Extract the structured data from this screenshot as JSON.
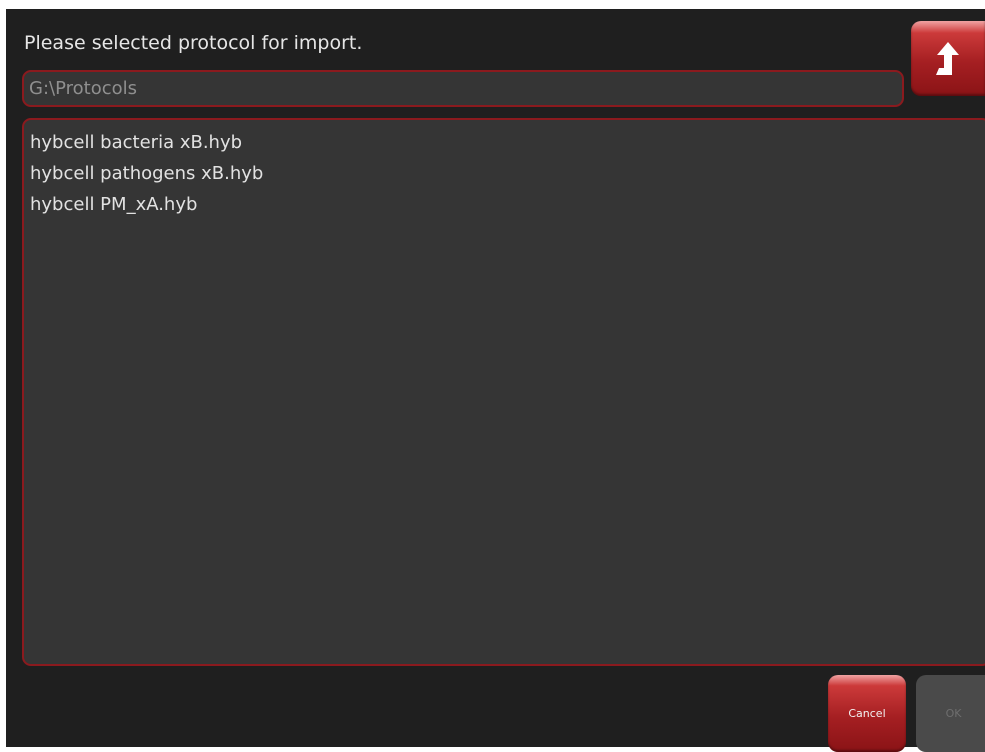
{
  "dialog": {
    "prompt": "Please selected protocol for import.",
    "path_value": "G:\\Protocols",
    "up_icon": "arrow-up-icon",
    "files": [
      {
        "name": "hybcell bacteria xB.hyb"
      },
      {
        "name": "hybcell pathogens xB.hyb"
      },
      {
        "name": "hybcell PM_xA.hyb"
      }
    ],
    "cancel_label": "Cancel",
    "ok_label": "OK",
    "colors": {
      "accent": "#a51f22",
      "border": "#8b1a1e",
      "background": "#1f1f1f",
      "panel": "#353535"
    }
  }
}
